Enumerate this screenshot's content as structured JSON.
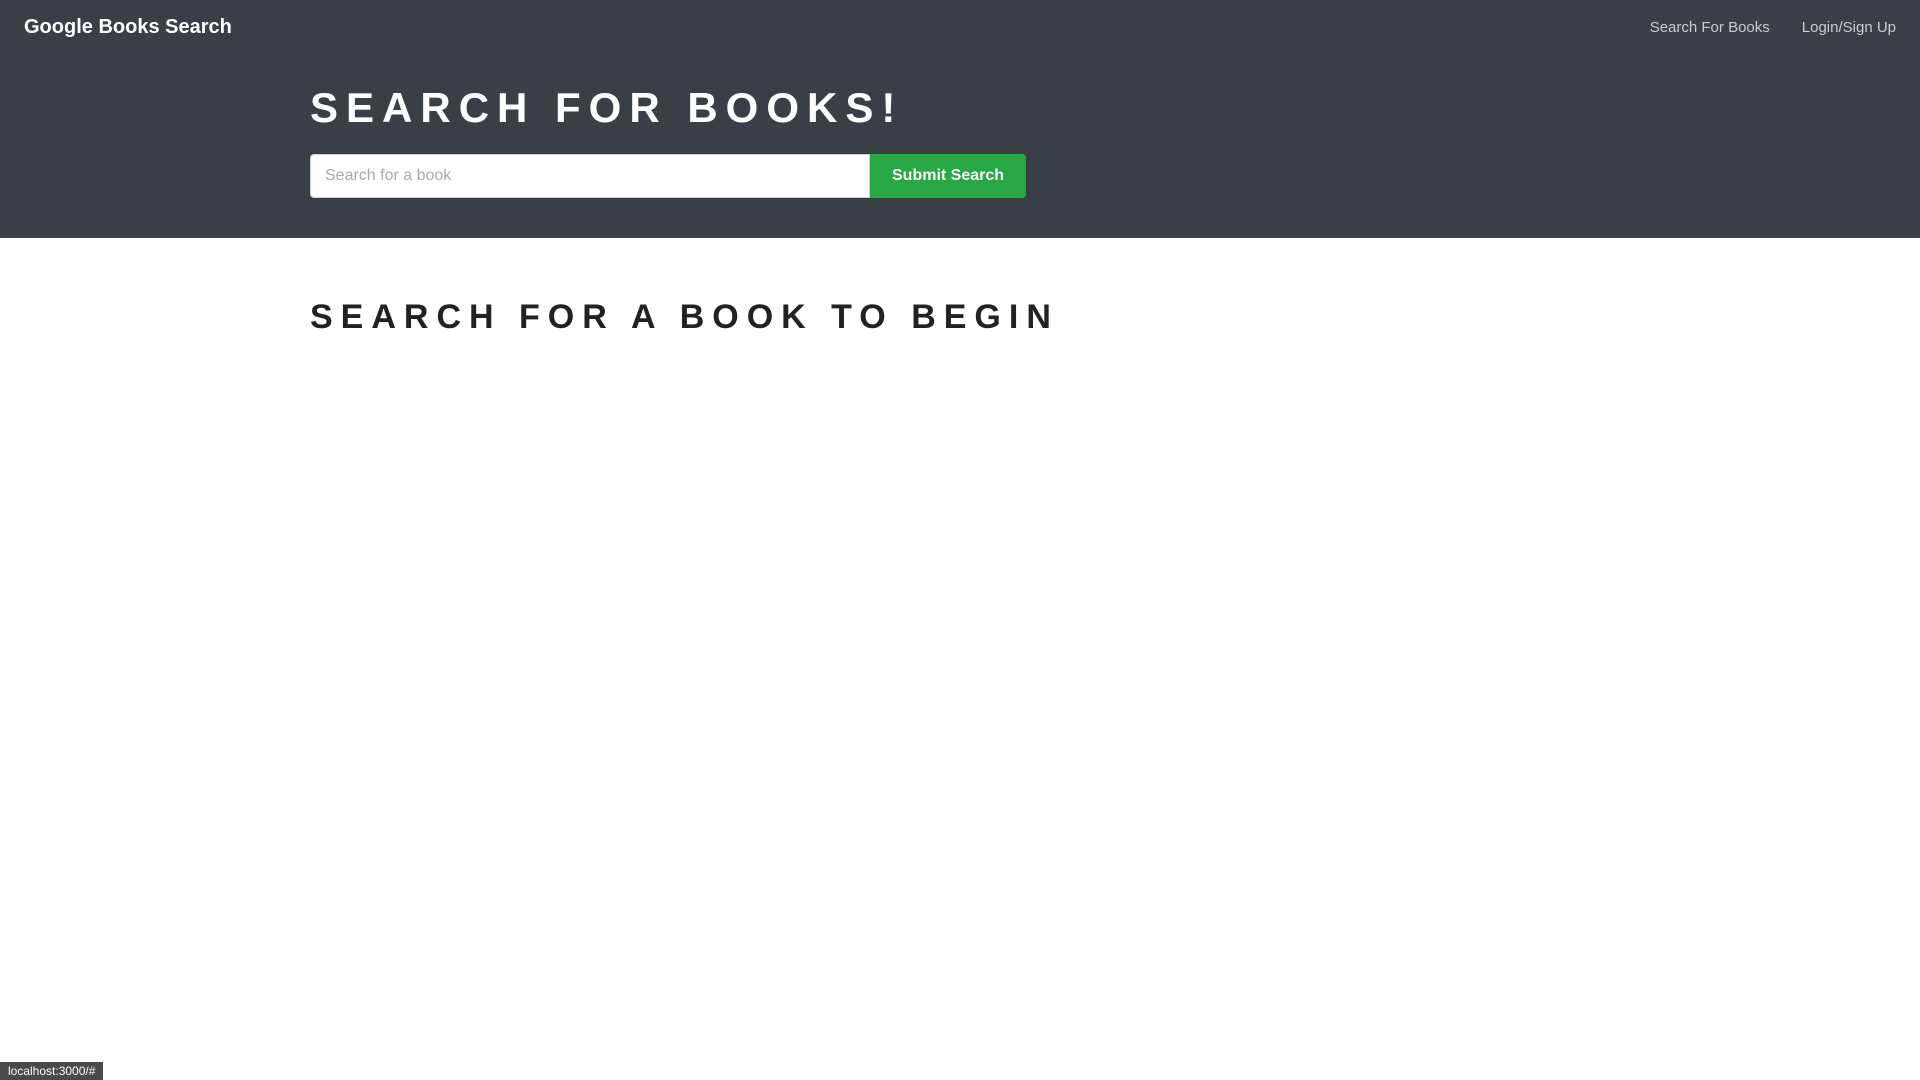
{
  "navbar": {
    "brand_label": "Google Books Search",
    "links": [
      {
        "id": "search-for-books",
        "label": "Search For Books"
      },
      {
        "id": "login-signup",
        "label": "Login/Sign Up"
      }
    ]
  },
  "search_section": {
    "title": "SEARCH FOR BOOKS!",
    "input_placeholder": "Search for a book",
    "button_label": "Submit Search"
  },
  "main_section": {
    "empty_state_message": "SEARCH FOR A BOOK TO BEGIN"
  },
  "status_bar": {
    "url": "localhost:3000/#"
  }
}
